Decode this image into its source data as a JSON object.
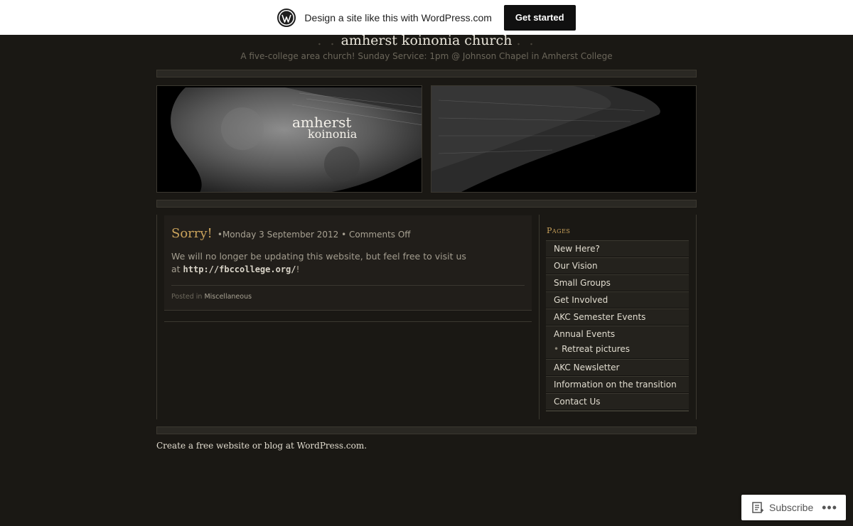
{
  "wp_banner": {
    "text": "Design a site like this with WordPress.com",
    "button": "Get started"
  },
  "header": {
    "title_dots_left": ". .",
    "title": "amherst koinonia church",
    "title_dots_right": ". .",
    "tagline": "A five-college area church! Sunday Service: 1pm @ Johnson Chapel in Amherst College",
    "logo_line1": "amherst",
    "logo_line2": "koinonia"
  },
  "post": {
    "title": "Sorry!",
    "meta_prefix": "•",
    "date": "Monday 3 September 2012",
    "meta_sep": " • ",
    "comments": "Comments Off",
    "body_line1": "We will no longer be updating this website, but feel free to visit us",
    "body_at": "at ",
    "body_link": "http://fbccollege.org/",
    "body_end": "!",
    "posted_in_label": "Posted in ",
    "category": "Miscellaneous"
  },
  "sidebar": {
    "heading": "Pages",
    "items": [
      {
        "label": "New Here?"
      },
      {
        "label": "Our Vision"
      },
      {
        "label": "Small Groups"
      },
      {
        "label": "Get Involved"
      },
      {
        "label": "AKC Semester Events"
      },
      {
        "label": "Annual Events",
        "child": "Retreat pictures"
      },
      {
        "label": "AKC Newsletter"
      },
      {
        "label": "Information on the transition"
      },
      {
        "label": "Contact Us"
      }
    ]
  },
  "footer": {
    "link": "Create a free website or blog at WordPress.com."
  },
  "subscribe": {
    "label": "Subscribe",
    "more": "•••"
  },
  "icons": {
    "wp_logo": "wordpress-logo-icon",
    "subscribe": "reader-subscribe-icon",
    "more": "ellipsis-icon"
  },
  "colors": {
    "background": "#1a1814",
    "accent": "#c9a25b",
    "post_bg": "#211e1a"
  }
}
